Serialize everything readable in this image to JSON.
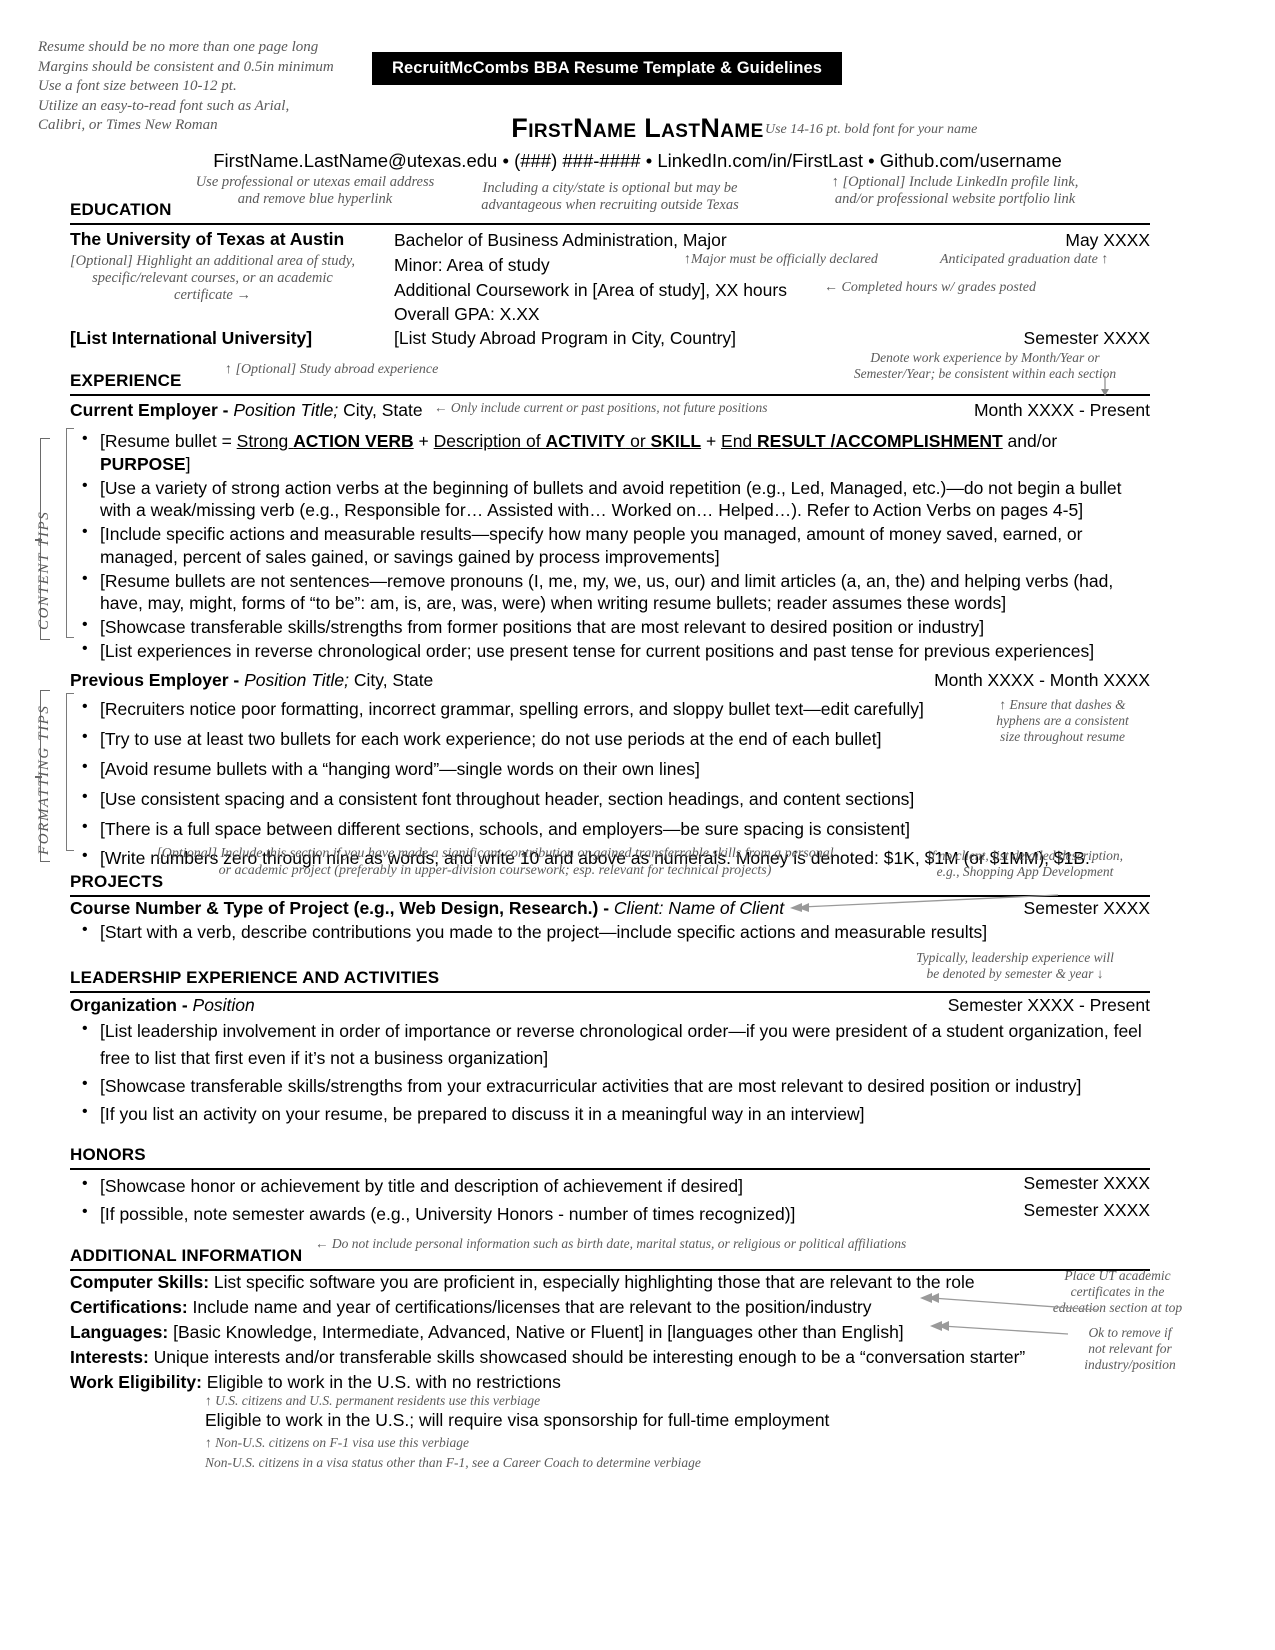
{
  "header": {
    "banner": "RecruitMcCombs BBA Resume Template & Guidelines",
    "name": "FirstName LastName",
    "contact": "FirstName.LastName@utexas.edu • (###) ###-#### • LinkedIn.com/in/FirstLast • Github.com/username",
    "name_note": "Use 14-16 pt. bold font for your name",
    "email_note": "Use professional or utexas email address\nand remove blue hyperlink",
    "city_note": "Including a city/state is optional but may be\nadvantageous when recruiting outside Texas",
    "linkedin_note": "↑ [Optional] Include LinkedIn profile link,\nand/or professional website portfolio link"
  },
  "top_guidelines": "Resume should be no more than one page long\nMargins should be consistent and 0.5in minimum\nUse a font size between 10-12 pt.\nUtilize an easy-to-read font such as Arial,\nCalibri, or Times New Roman",
  "side_labels": {
    "content": "CONTENT TIPS",
    "formatting": "FORMATTING TIPS"
  },
  "education": {
    "heading": "EDUCATION",
    "school": "The University of Texas at Austin",
    "degree": "Bachelor of Business Administration, Major",
    "date": "May XXXX",
    "minor": "Minor: Area of study",
    "coursework": "Additional Coursework in [Area of study], XX hours",
    "gpa": "Overall GPA: X.XX",
    "abroad_school": "[List International University]",
    "abroad_program": "[List Study Abroad Program in City, Country]",
    "abroad_date": "Semester XXXX",
    "note_left": "[Optional] Highlight an additional area of study,\nspecific/relevant courses, or an academic\ncertificate →",
    "note_major": "↑Major must be officially declared",
    "note_grad": "Anticipated graduation date ↑",
    "note_hours": "← Completed hours w/ grades posted",
    "note_abroad": "↑ [Optional] Study abroad experience"
  },
  "experience": {
    "heading": "EXPERIENCE",
    "note_dates": "Denote work experience by Month/Year or\nSemester/Year; be consistent within each section",
    "current": {
      "employer": "Current Employer",
      "separator": " - ",
      "position": "Position Title;",
      "location": " City, State",
      "date": "Month XXXX - Present",
      "note": "← Only include current or past positions, not future positions",
      "bullets_rich": [
        [
          {
            "t": "[Resume bullet = ",
            "s": ""
          },
          {
            "t": "Strong ",
            "s": "u"
          },
          {
            "t": "ACTION VERB",
            "s": "u b"
          },
          {
            "t": " + ",
            "s": ""
          },
          {
            "t": "Description of ",
            "s": "u"
          },
          {
            "t": "ACTIVITY",
            "s": "u b"
          },
          {
            "t": " or ",
            "s": "u"
          },
          {
            "t": "SKILL",
            "s": "u b"
          },
          {
            "t": " + ",
            "s": ""
          },
          {
            "t": "End ",
            "s": "u"
          },
          {
            "t": "RESULT /ACCOMPLISHMENT",
            "s": "u b"
          },
          {
            "t": " and/or ",
            "s": ""
          },
          {
            "t": "PURPOSE",
            "s": "b"
          },
          {
            "t": "]",
            "s": ""
          }
        ]
      ],
      "bullets": [
        "[Use a variety of strong action verbs at the beginning of bullets and avoid repetition (e.g., Led, Managed, etc.)—do not begin a bullet with a weak/missing verb (e.g., Responsible for… Assisted with… Worked on… Helped…). Refer to Action Verbs on pages 4-5]",
        "[Include specific actions and measurable results—specify how many people you managed, amount of money saved, earned, or managed, percent of sales gained, or savings gained by process improvements]",
        "[Resume bullets are not sentences—remove pronouns (I, me, my, we, us, our) and limit articles (a, an, the) and helping verbs (had, have, may, might, forms of “to be”: am, is, are, was, were) when writing resume bullets; reader assumes these words]",
        "[Showcase transferable skills/strengths from former positions that are most relevant to desired position or industry]",
        "[List experiences in reverse chronological order; use present tense for current positions and past tense for previous experiences]"
      ]
    },
    "previous": {
      "employer": "Previous Employer",
      "separator": " - ",
      "position": "Position Title;",
      "location": " City, State",
      "date": "Month XXXX - Month XXXX",
      "note": "↑ Ensure that dashes &\nhyphens are a consistent\nsize throughout resume",
      "bullets": [
        "[Recruiters notice poor formatting, incorrect grammar, spelling errors, and sloppy bullet text—edit carefully]",
        "[Try to use at least two bullets for each work experience; do not use periods at the end of each bullet]",
        "[Avoid resume bullets with a “hanging word”—single words on their own lines]",
        "[Use consistent spacing and a consistent font throughout header, section headings, and content sections]",
        "[There is a full space between different sections, schools, and employers—be sure spacing is consistent]",
        "[Write numbers zero through nine as words, and write 10 and above as numerals. Money is denoted:  $1K, $1M (or $1MM), $1B."
      ]
    }
  },
  "projects": {
    "heading": "PROJECTS",
    "note_top": "[Optional] Include this section if you have made a significant contribution or gained transferrable skills from a personal\nor academic project (preferably in upper-division coursework; esp. relevant for technical projects)",
    "note_client": "If no client, list detailed description,\ne.g., Shopping App Development",
    "title_bold": "Course Number & Type of Project (e.g., Web Design, Research.)",
    "title_sep": " - ",
    "title_italic": "Client: Name of Client",
    "date": "Semester XXXX",
    "bullets": [
      "[Start with a verb, describe contributions you made to the project—include specific actions and measurable results]"
    ]
  },
  "leadership": {
    "heading": "LEADERSHIP EXPERIENCE AND ACTIVITIES",
    "note": "Typically, leadership experience will\nbe denoted by semester & year ↓",
    "org_bold": "Organization",
    "org_sep": " - ",
    "org_italic": "Position",
    "date": "Semester XXXX - Present",
    "bullets": [
      "[List leadership involvement in order of importance or reverse chronological order—if you were president of a student organization, feel free to list that first even if it’s not a business organization]",
      "[Showcase transferable skills/strengths from your extracurricular activities that are most relevant to desired position or industry]",
      "[If you list an activity on your resume, be prepared to discuss it in a meaningful way in an interview]"
    ]
  },
  "honors": {
    "heading": "HONORS",
    "items": [
      {
        "text": "[Showcase honor or achievement by title and description of achievement if desired]",
        "date": "Semester XXXX"
      },
      {
        "text": "[If possible, note semester awards (e.g., University Honors - number of times recognized)]",
        "date": "Semester XXXX"
      }
    ]
  },
  "additional": {
    "heading": "ADDITIONAL INFORMATION",
    "note": "← Do not include personal information such as birth date, marital status, or religious or political affiliations",
    "note_cert": "Place UT academic\ncertificates in the\neducation section at top",
    "note_lang": "Ok to remove if\nnot relevant for\nindustry/position",
    "rows": [
      {
        "label": "Computer Skills:",
        "value": " List specific software you are proficient in, especially highlighting those that are relevant to the role"
      },
      {
        "label": "Certifications:",
        "value": " Include name and year of certifications/licenses that are relevant to the position/industry"
      },
      {
        "label": "Languages:",
        "value": " [Basic Knowledge, Intermediate, Advanced, Native or Fluent] in [languages other than English]"
      },
      {
        "label": "Interests:",
        "value": " Unique interests and/or transferable skills showcased should be interesting enough to be a “conversation starter”"
      },
      {
        "label": "Work Eligibility:",
        "value": " Eligible to work in the U.S. with no restrictions"
      }
    ],
    "visa_note_1": "↑ U.S. citizens and U.S. permanent residents use this verbiage",
    "visa_line": "Eligible to work in the U.S.; will require visa sponsorship for full-time employment",
    "visa_note_2": "↑ Non-U.S. citizens on F-1 visa use this verbiage",
    "visa_note_3": "Non-U.S. citizens in a visa status other than F-1, see a Career Coach to determine verbiage"
  }
}
